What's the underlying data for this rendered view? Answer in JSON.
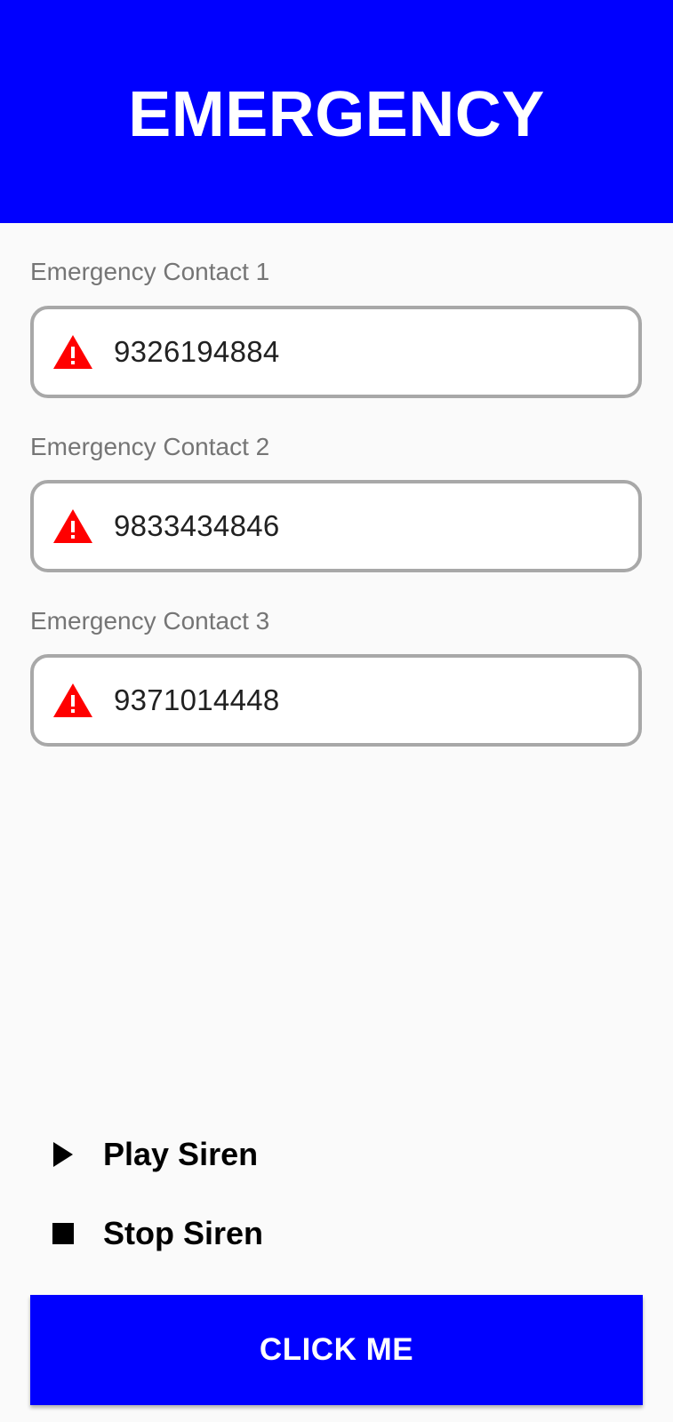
{
  "header": {
    "title": "EMERGENCY"
  },
  "contacts": [
    {
      "label": "Emergency Contact 1",
      "value": "9326194884",
      "icon": "warning-icon"
    },
    {
      "label": "Emergency Contact 2",
      "value": "9833434846",
      "icon": "warning-icon"
    },
    {
      "label": "Emergency Contact 3",
      "value": "9371014448",
      "icon": "warning-icon"
    }
  ],
  "siren": {
    "play_label": "Play Siren",
    "play_icon": "play-icon",
    "stop_label": "Stop Siren",
    "stop_icon": "stop-icon"
  },
  "button": {
    "label": "CLICK ME"
  },
  "colors": {
    "primary": "#0000ff",
    "warning": "#ff0000",
    "field_border": "#a8a8a8",
    "label_gray": "#757575"
  }
}
